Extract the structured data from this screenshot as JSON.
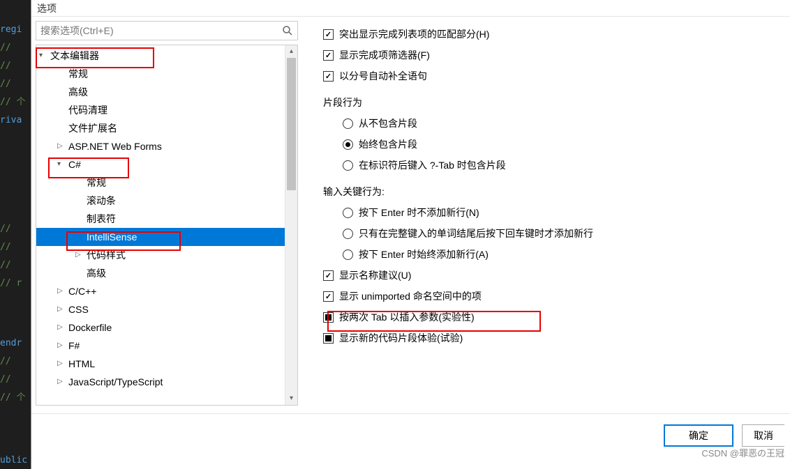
{
  "dialog": {
    "title": "选项"
  },
  "search": {
    "placeholder": "搜索选项(Ctrl+E)"
  },
  "tree": {
    "items": [
      {
        "label": "文本编辑器",
        "level": 0,
        "expander": "▾"
      },
      {
        "label": "常规",
        "level": 1,
        "expander": ""
      },
      {
        "label": "高级",
        "level": 1,
        "expander": ""
      },
      {
        "label": "代码清理",
        "level": 1,
        "expander": ""
      },
      {
        "label": "文件扩展名",
        "level": 1,
        "expander": ""
      },
      {
        "label": "ASP.NET Web Forms",
        "level": 1,
        "expander": "▷"
      },
      {
        "label": "C#",
        "level": 1,
        "expander": "▾"
      },
      {
        "label": "常规",
        "level": 2,
        "expander": ""
      },
      {
        "label": "滚动条",
        "level": 2,
        "expander": ""
      },
      {
        "label": "制表符",
        "level": 2,
        "expander": ""
      },
      {
        "label": "IntelliSense",
        "level": 2,
        "expander": "",
        "selected": true
      },
      {
        "label": "代码样式",
        "level": 2,
        "expander": "▷"
      },
      {
        "label": "高级",
        "level": 2,
        "expander": ""
      },
      {
        "label": "C/C++",
        "level": 1,
        "expander": "▷"
      },
      {
        "label": "CSS",
        "level": 1,
        "expander": "▷"
      },
      {
        "label": "Dockerfile",
        "level": 1,
        "expander": "▷"
      },
      {
        "label": "F#",
        "level": 1,
        "expander": "▷"
      },
      {
        "label": "HTML",
        "level": 1,
        "expander": "▷"
      },
      {
        "label": "JavaScript/TypeScript",
        "level": 1,
        "expander": "▷"
      }
    ]
  },
  "options": {
    "topChecks": [
      {
        "label": "突出显示完成列表项的匹配部分(H)",
        "state": "checked"
      },
      {
        "label": "显示完成项筛选器(F)",
        "state": "checked"
      },
      {
        "label": "以分号自动补全语句",
        "state": "checked"
      }
    ],
    "snippetHeader": "片段行为",
    "snippetRadios": [
      {
        "label": "从不包含片段",
        "selected": false
      },
      {
        "label": "始终包含片段",
        "selected": true
      },
      {
        "label": "在标识符后键入 ?-Tab 时包含片段",
        "selected": false
      }
    ],
    "enterHeader": "输入关键行为:",
    "enterRadios": [
      {
        "label": "按下 Enter 时不添加新行(N)",
        "selected": false
      },
      {
        "label": "只有在完整键入的单词结尾后按下回车键时才添加新行",
        "selected": false
      },
      {
        "label": "按下 Enter 时始终添加新行(A)",
        "selected": false
      }
    ],
    "bottomChecks": [
      {
        "label": "显示名称建议(U)",
        "state": "checked"
      },
      {
        "label": "显示 unimported 命名空间中的项",
        "state": "checked"
      },
      {
        "label": "按两次 Tab 以插入参数(实验性)",
        "state": "indeterminate"
      },
      {
        "label": "显示新的代码片段体验(试验)",
        "state": "indeterminate"
      }
    ]
  },
  "footer": {
    "ok": "确定",
    "cancel": "取消"
  },
  "watermark": "CSDN @罪恶の王冠",
  "codebg": {
    "l1": "regi",
    "l2": "//",
    "l3": "//",
    "l4": "//",
    "l5": "// 个",
    "l6": "riva",
    "l7": "//",
    "l8": "//",
    "l9": "//",
    "l10": "// r",
    "l11": "endr",
    "l12": "//",
    "l13": "//",
    "l14": "// 个",
    "bottom": "ublic DelegateCommand<MenuBar> NavigateCommand { get; set; }"
  }
}
